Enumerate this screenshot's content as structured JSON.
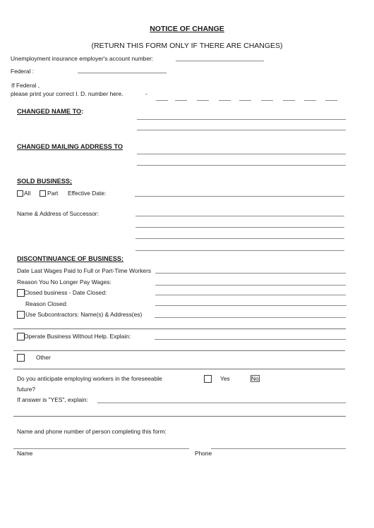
{
  "header": {
    "title": "NOTICE OF CHANGE",
    "subtitle": "(RETURN THIS FORM ONLY IF THERE ARE CHANGES)"
  },
  "account": {
    "ui_account_label": "Unemployment insurance employer's account number:",
    "ui_account_value": "",
    "federal_label": "Federal  :",
    "federal_value": "",
    "if_federal_label": "If Federal  ,",
    "print_id_label": "please print your correct I. D. number here.",
    "id_dash": "-",
    "id_digits": [
      "",
      "",
      "",
      "",
      "",
      "",
      "",
      "",
      ""
    ]
  },
  "changed_name": {
    "heading": "CHANGED NAME TO",
    "heading_suffix": ":",
    "lines": [
      "",
      ""
    ]
  },
  "changed_address": {
    "heading": "CHANGED MAILING ADDRESS TO",
    "lines": [
      "",
      ""
    ]
  },
  "sold_business": {
    "heading": "SOLD BUSINESS",
    "heading_suffix": ";",
    "all_label": "All",
    "all_checked": false,
    "part_label": "Part",
    "part_checked": false,
    "effective_date_label": "Effective Date:",
    "effective_date_value": "",
    "successor_label": "Name & Address of Successor:",
    "successor_lines": [
      "",
      "",
      "",
      ""
    ]
  },
  "discontinuance": {
    "heading": "DISCONTINUANCE OF BUSINESS",
    "heading_suffix": ":",
    "last_wages_label": "Date Last Wages Paid to Full or Part-Time Workers",
    "no_wages_label": "Reason You No Longer Pay Wages:",
    "closed_label": "Closed business - Date Closed:",
    "closed_checked": false,
    "reason_closed_label": "Reason Closed:",
    "subcontractors_label": "Use Subcontractors: Name(s) & Address(es)",
    "subcontractors_checked": false,
    "without_help_label": "Operate Business Without Help.  Explain:",
    "without_help_checked": false,
    "other_label": "Other",
    "other_checked": false
  },
  "future": {
    "question_line1": "Do you anticipate employing workers in the foreseeable",
    "question_line2": "future?",
    "yes_label": "Yes",
    "yes_checked": false,
    "no_label": "No",
    "no_checked": false,
    "explain_label": "If answer is \"YES\", explain:"
  },
  "contact": {
    "prompt": "Name and phone number of person completing this form:",
    "name_label": "Name",
    "name_value": "",
    "phone_label": "Phone",
    "phone_value": ""
  }
}
